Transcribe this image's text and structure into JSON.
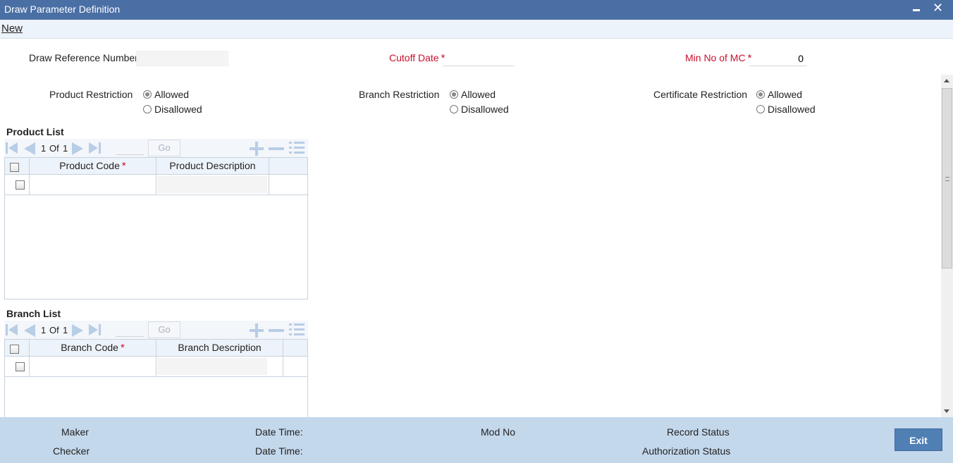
{
  "window": {
    "title": "Draw Parameter Definition",
    "minimize_label": "",
    "close_label": "✕"
  },
  "menu": {
    "new_label": "New"
  },
  "form": {
    "draw_ref": {
      "label": "Draw Reference Number",
      "value": ""
    },
    "cutoff_date": {
      "label": "Cutoff Date",
      "required": "*",
      "value": ""
    },
    "min_mc": {
      "label": "Min No of MC",
      "required": "*",
      "value": "0"
    },
    "product_restriction": {
      "label": "Product Restriction",
      "options": [
        "Allowed",
        "Disallowed"
      ],
      "selected": "Allowed"
    },
    "branch_restriction": {
      "label": "Branch Restriction",
      "options": [
        "Allowed",
        "Disallowed"
      ],
      "selected": "Allowed"
    },
    "certificate_restriction": {
      "label": "Certificate Restriction",
      "options": [
        "Allowed",
        "Disallowed"
      ],
      "selected": "Allowed"
    }
  },
  "product_list": {
    "title": "Product List",
    "pager": {
      "current": "1",
      "of_label": "Of",
      "total": "1",
      "go_label": "Go"
    },
    "columns": [
      {
        "label": "Product Code",
        "required": "*"
      },
      {
        "label": "Product Description"
      }
    ],
    "rows": [
      {
        "code": "",
        "description": ""
      }
    ]
  },
  "branch_list": {
    "title": "Branch List",
    "pager": {
      "current": "1",
      "of_label": "Of",
      "total": "1",
      "go_label": "Go"
    },
    "columns": [
      {
        "label": "Branch Code",
        "required": "*"
      },
      {
        "label": "Branch Description"
      }
    ],
    "rows": [
      {
        "code": "",
        "description": ""
      }
    ]
  },
  "footer": {
    "maker_label": "Maker",
    "checker_label": "Checker",
    "date_time_label_1": "Date Time:",
    "date_time_label_2": "Date Time:",
    "mod_no_label": "Mod No",
    "record_status_label": "Record Status",
    "auth_status_label": "Authorization Status",
    "exit_label": "Exit"
  }
}
